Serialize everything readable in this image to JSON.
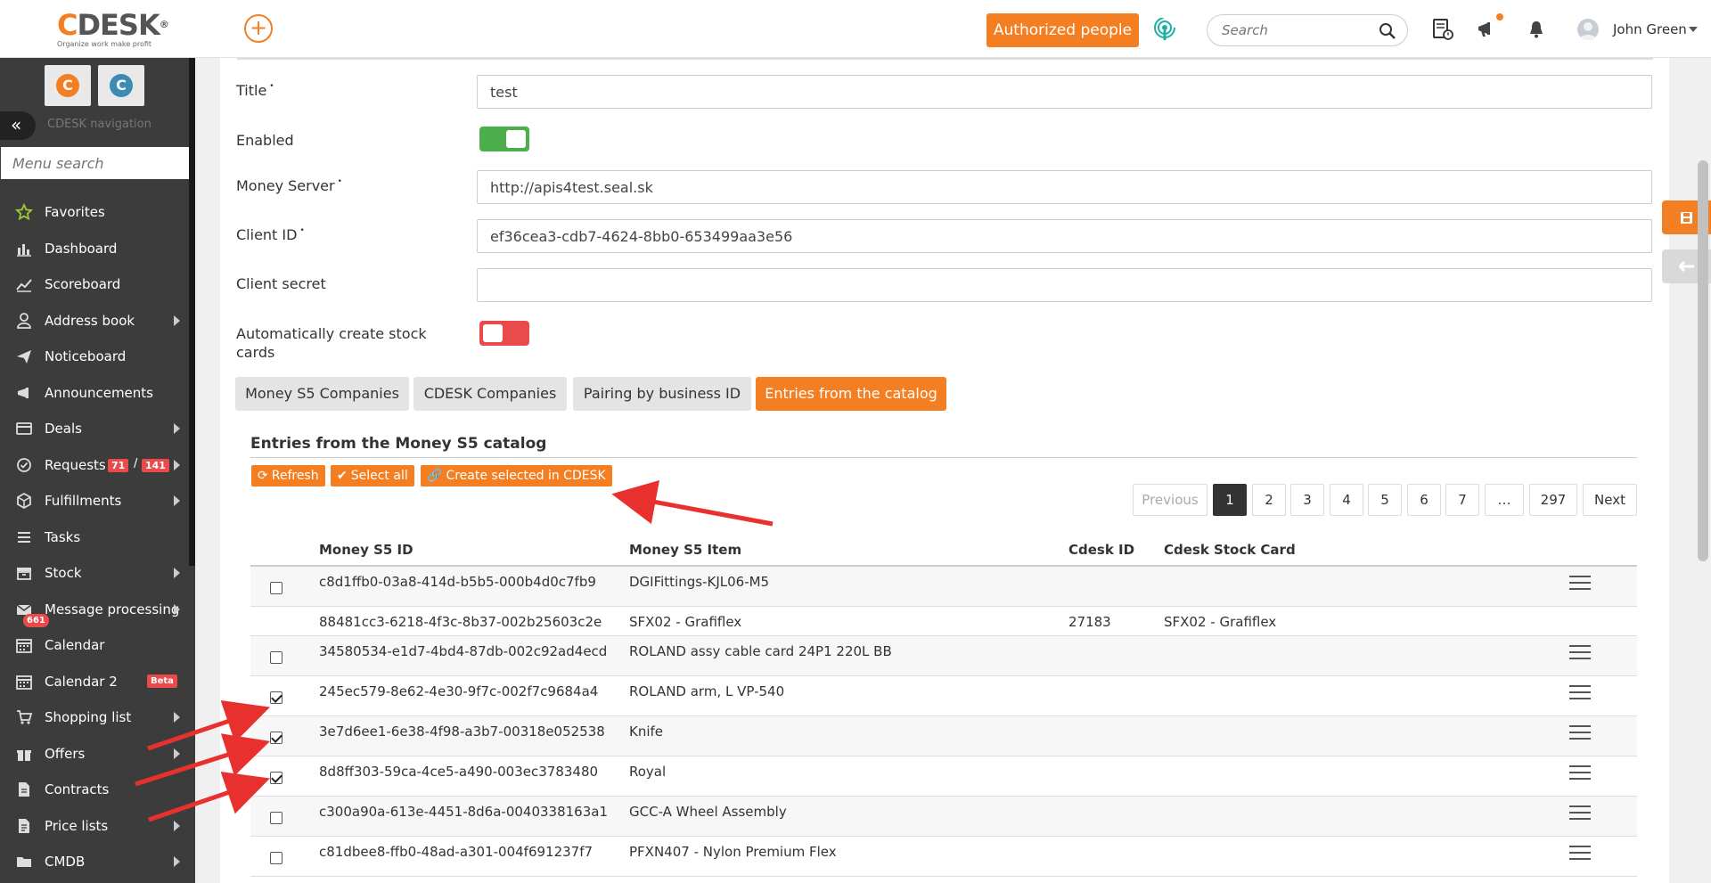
{
  "header": {
    "logo_text": "CDESK",
    "logo_tagline": "Organize work make profit",
    "authorized_people": "Authorized people",
    "search_placeholder": "Search",
    "user_name": "John Green"
  },
  "sidebar": {
    "nav_title": "CDESK navigation",
    "menu_search_placeholder": "Menu search",
    "items": [
      {
        "label": "Favorites",
        "icon": "star-icon"
      },
      {
        "label": "Dashboard",
        "icon": "bar-chart-icon"
      },
      {
        "label": "Scoreboard",
        "icon": "line-chart-icon"
      },
      {
        "label": "Address book",
        "icon": "user-icon"
      },
      {
        "label": "Noticeboard",
        "icon": "paper-plane-icon"
      },
      {
        "label": "Announcements",
        "icon": "megaphone-icon"
      },
      {
        "label": "Deals",
        "icon": "credit-card-icon"
      },
      {
        "label": "Requests",
        "icon": "check-circle-icon",
        "badge1": "71",
        "separator": "/",
        "badge2": "141"
      },
      {
        "label": "Fulfillments",
        "icon": "box-icon"
      },
      {
        "label": "Tasks",
        "icon": "list-icon"
      },
      {
        "label": "Stock",
        "icon": "archive-icon"
      },
      {
        "label": "Message processing",
        "icon": "envelope-icon",
        "badge": "661"
      },
      {
        "label": "Calendar",
        "icon": "calendar-icon"
      },
      {
        "label": "Calendar 2",
        "icon": "calendar-icon",
        "badge": "Beta"
      },
      {
        "label": "Shopping list",
        "icon": "cart-icon"
      },
      {
        "label": "Offers",
        "icon": "gift-icon"
      },
      {
        "label": "Contracts",
        "icon": "document-icon"
      },
      {
        "label": "Price lists",
        "icon": "price-list-icon"
      },
      {
        "label": "CMDB",
        "icon": "folder-icon"
      }
    ]
  },
  "form": {
    "title_label": "Title",
    "title_value": "test",
    "enabled_label": "Enabled",
    "enabled": true,
    "money_server_label": "Money Server",
    "money_server_value": "http://apis4test.seal.sk",
    "client_id_label": "Client ID",
    "client_id_value": "ef36cea3-cdb7-4624-8bb0-653499aa3e56",
    "client_secret_label": "Client secret",
    "client_secret_value": "",
    "auto_stock_label": "Automatically create stock cards",
    "auto_stock": false,
    "required_marker": "•"
  },
  "tabs": [
    {
      "label": "Money S5 Companies",
      "active": false
    },
    {
      "label": "CDESK Companies",
      "active": false
    },
    {
      "label": "Pairing by business ID",
      "active": false
    },
    {
      "label": "Entries from the catalog",
      "active": true
    }
  ],
  "catalog": {
    "title": "Entries from the Money S5 catalog",
    "refresh": "Refresh",
    "select_all": "Select all",
    "create_selected": "Create selected in CDESK",
    "pagination": {
      "previous": "Previous",
      "pages": [
        "1",
        "2",
        "3",
        "4",
        "5",
        "6",
        "7",
        "…",
        "297"
      ],
      "current": "1",
      "next": "Next"
    },
    "columns": [
      "Money S5 ID",
      "Money S5 Item",
      "Cdesk ID",
      "Cdesk Stock Card"
    ],
    "rows": [
      {
        "id": "c8d1ffb0-03a8-414d-b5b5-000b4d0c7fb9",
        "item": "DGIFittings-KJL06-M5",
        "cdesk_id": "",
        "stock_card": "",
        "checkbox": true,
        "checked": false
      },
      {
        "id": "88481cc3-6218-4f3c-8b37-002b25603c2e",
        "item": "SFX02 - Grafiflex",
        "cdesk_id": "27183",
        "stock_card": "SFX02 - Grafiflex",
        "checkbox": false,
        "checked": false
      },
      {
        "id": "34580534-e1d7-4bd4-87db-002c92ad4ecd",
        "item": "ROLAND assy cable card 24P1 220L BB",
        "cdesk_id": "",
        "stock_card": "",
        "checkbox": true,
        "checked": false
      },
      {
        "id": "245ec579-8e62-4e30-9f7c-002f7c9684a4",
        "item": "ROLAND arm, L VP-540",
        "cdesk_id": "",
        "stock_card": "",
        "checkbox": true,
        "checked": true
      },
      {
        "id": "3e7d6ee1-6e38-4f98-a3b7-00318e052538",
        "item": "Knife",
        "cdesk_id": "",
        "stock_card": "",
        "checkbox": true,
        "checked": true
      },
      {
        "id": "8d8ff303-59ca-4ce5-a490-003ec3783480",
        "item": "Royal",
        "cdesk_id": "",
        "stock_card": "",
        "checkbox": true,
        "checked": true
      },
      {
        "id": "c300a90a-613e-4451-8d6a-0040338163a1",
        "item": "GCC-A Wheel Assembly",
        "cdesk_id": "",
        "stock_card": "",
        "checkbox": true,
        "checked": false
      },
      {
        "id": "c81dbee8-ffb0-48ad-a301-004f691237f7",
        "item": "PFXN407 - Nylon Premium Flex",
        "cdesk_id": "",
        "stock_card": "",
        "checkbox": true,
        "checked": false
      }
    ]
  },
  "colors": {
    "accent": "#f47f22",
    "sidebar_bg": "#3c3c3c",
    "toggle_on": "#4cae4c",
    "toggle_off": "#e94a4a",
    "annotation_arrow": "#e8312f"
  }
}
